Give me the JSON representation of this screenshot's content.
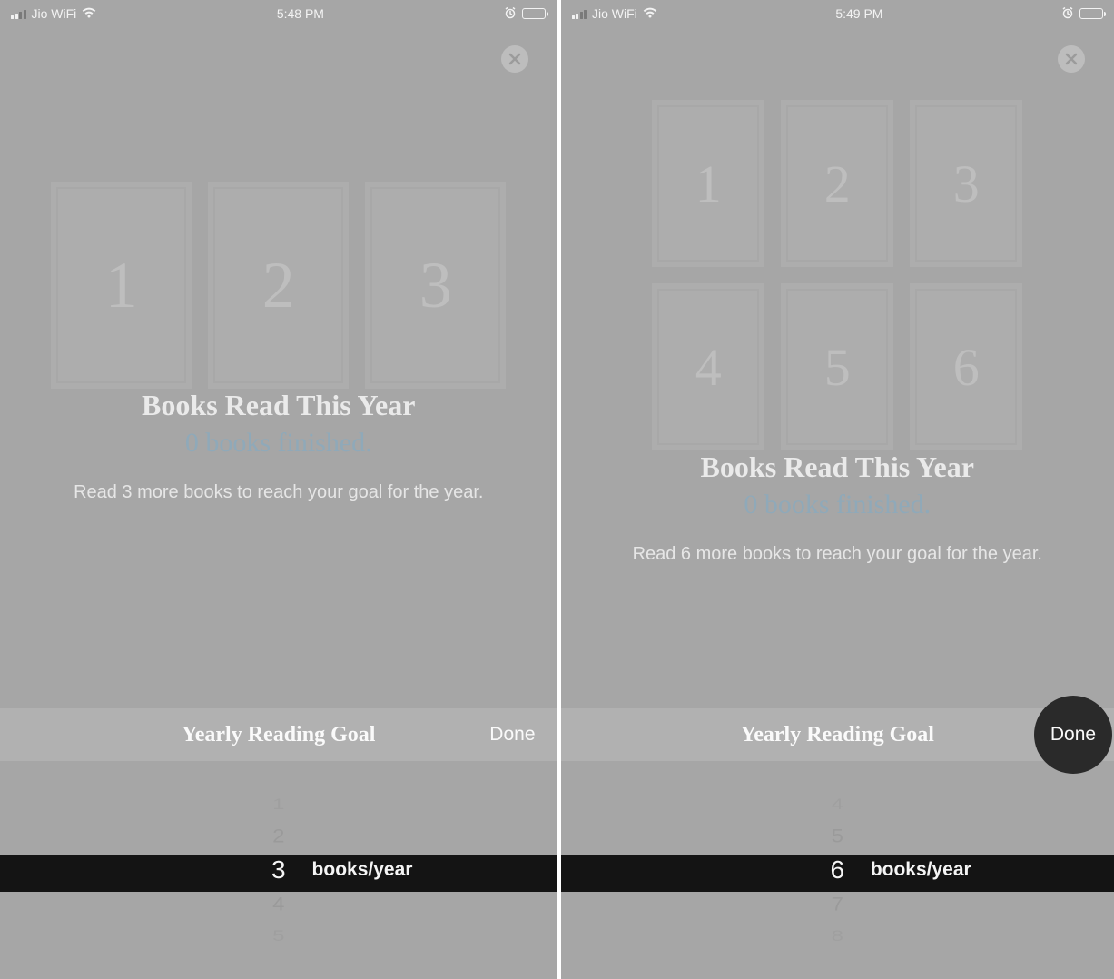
{
  "left": {
    "status": {
      "carrier": "Jio WiFi",
      "time": "5:48 PM"
    },
    "books": [
      "1",
      "2",
      "3"
    ],
    "title": "Books Read This Year",
    "subtitle": "0 books finished.",
    "hint": "Read 3 more books to reach your goal for the year.",
    "picker": {
      "title": "Yearly Reading Goal",
      "done": "Done",
      "opts": [
        "1",
        "2",
        "3",
        "4",
        "5"
      ],
      "selected": 2,
      "unit": "books/year"
    }
  },
  "right": {
    "status": {
      "carrier": "Jio WiFi",
      "time": "5:49 PM"
    },
    "books": [
      "1",
      "2",
      "3",
      "4",
      "5",
      "6"
    ],
    "title": "Books Read This Year",
    "subtitle": "0 books finished.",
    "hint": "Read 6 more books to reach your goal for the year.",
    "picker": {
      "title": "Yearly Reading Goal",
      "done": "Done",
      "opts": [
        "4",
        "5",
        "6",
        "7",
        "8"
      ],
      "selected": 2,
      "unit": "books/year"
    }
  }
}
